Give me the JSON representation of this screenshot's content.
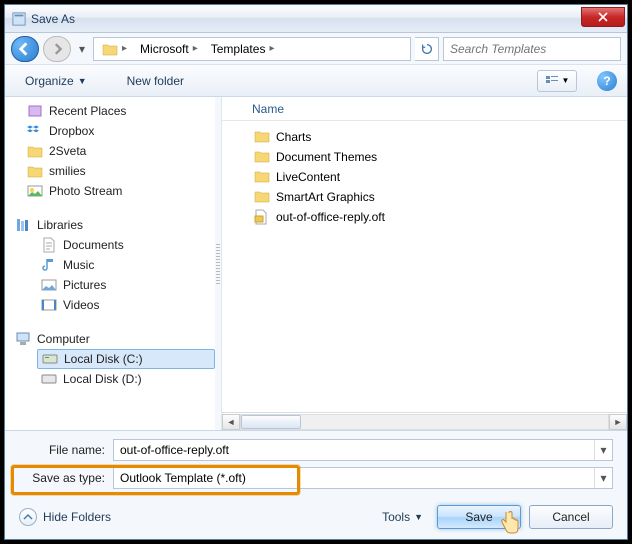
{
  "title": "Save As",
  "breadcrumb": {
    "seg1": "Microsoft",
    "seg2": "Templates"
  },
  "search": {
    "placeholder": "Search Templates"
  },
  "toolbar": {
    "organize": "Organize",
    "newfolder": "New folder"
  },
  "tree": {
    "recent": "Recent Places",
    "dropbox": "Dropbox",
    "sveta": "2Sveta",
    "smilies": "smilies",
    "photostream": "Photo Stream",
    "libraries": "Libraries",
    "documents": "Documents",
    "music": "Music",
    "pictures": "Pictures",
    "videos": "Videos",
    "computer": "Computer",
    "localc": "Local Disk (C:)",
    "locald": "Local Disk (D:)"
  },
  "listheader": {
    "name": "Name"
  },
  "list": {
    "charts": "Charts",
    "themes": "Document Themes",
    "live": "LiveContent",
    "smartart": "SmartArt Graphics",
    "oft": "out-of-office-reply.oft"
  },
  "form": {
    "filename_label": "File name:",
    "filename_value": "out-of-office-reply.oft",
    "filetype_label": "Save as type:",
    "filetype_value": "Outlook Template (*.oft)"
  },
  "buttons": {
    "hide": "Hide Folders",
    "tools": "Tools",
    "save": "Save",
    "cancel": "Cancel"
  }
}
